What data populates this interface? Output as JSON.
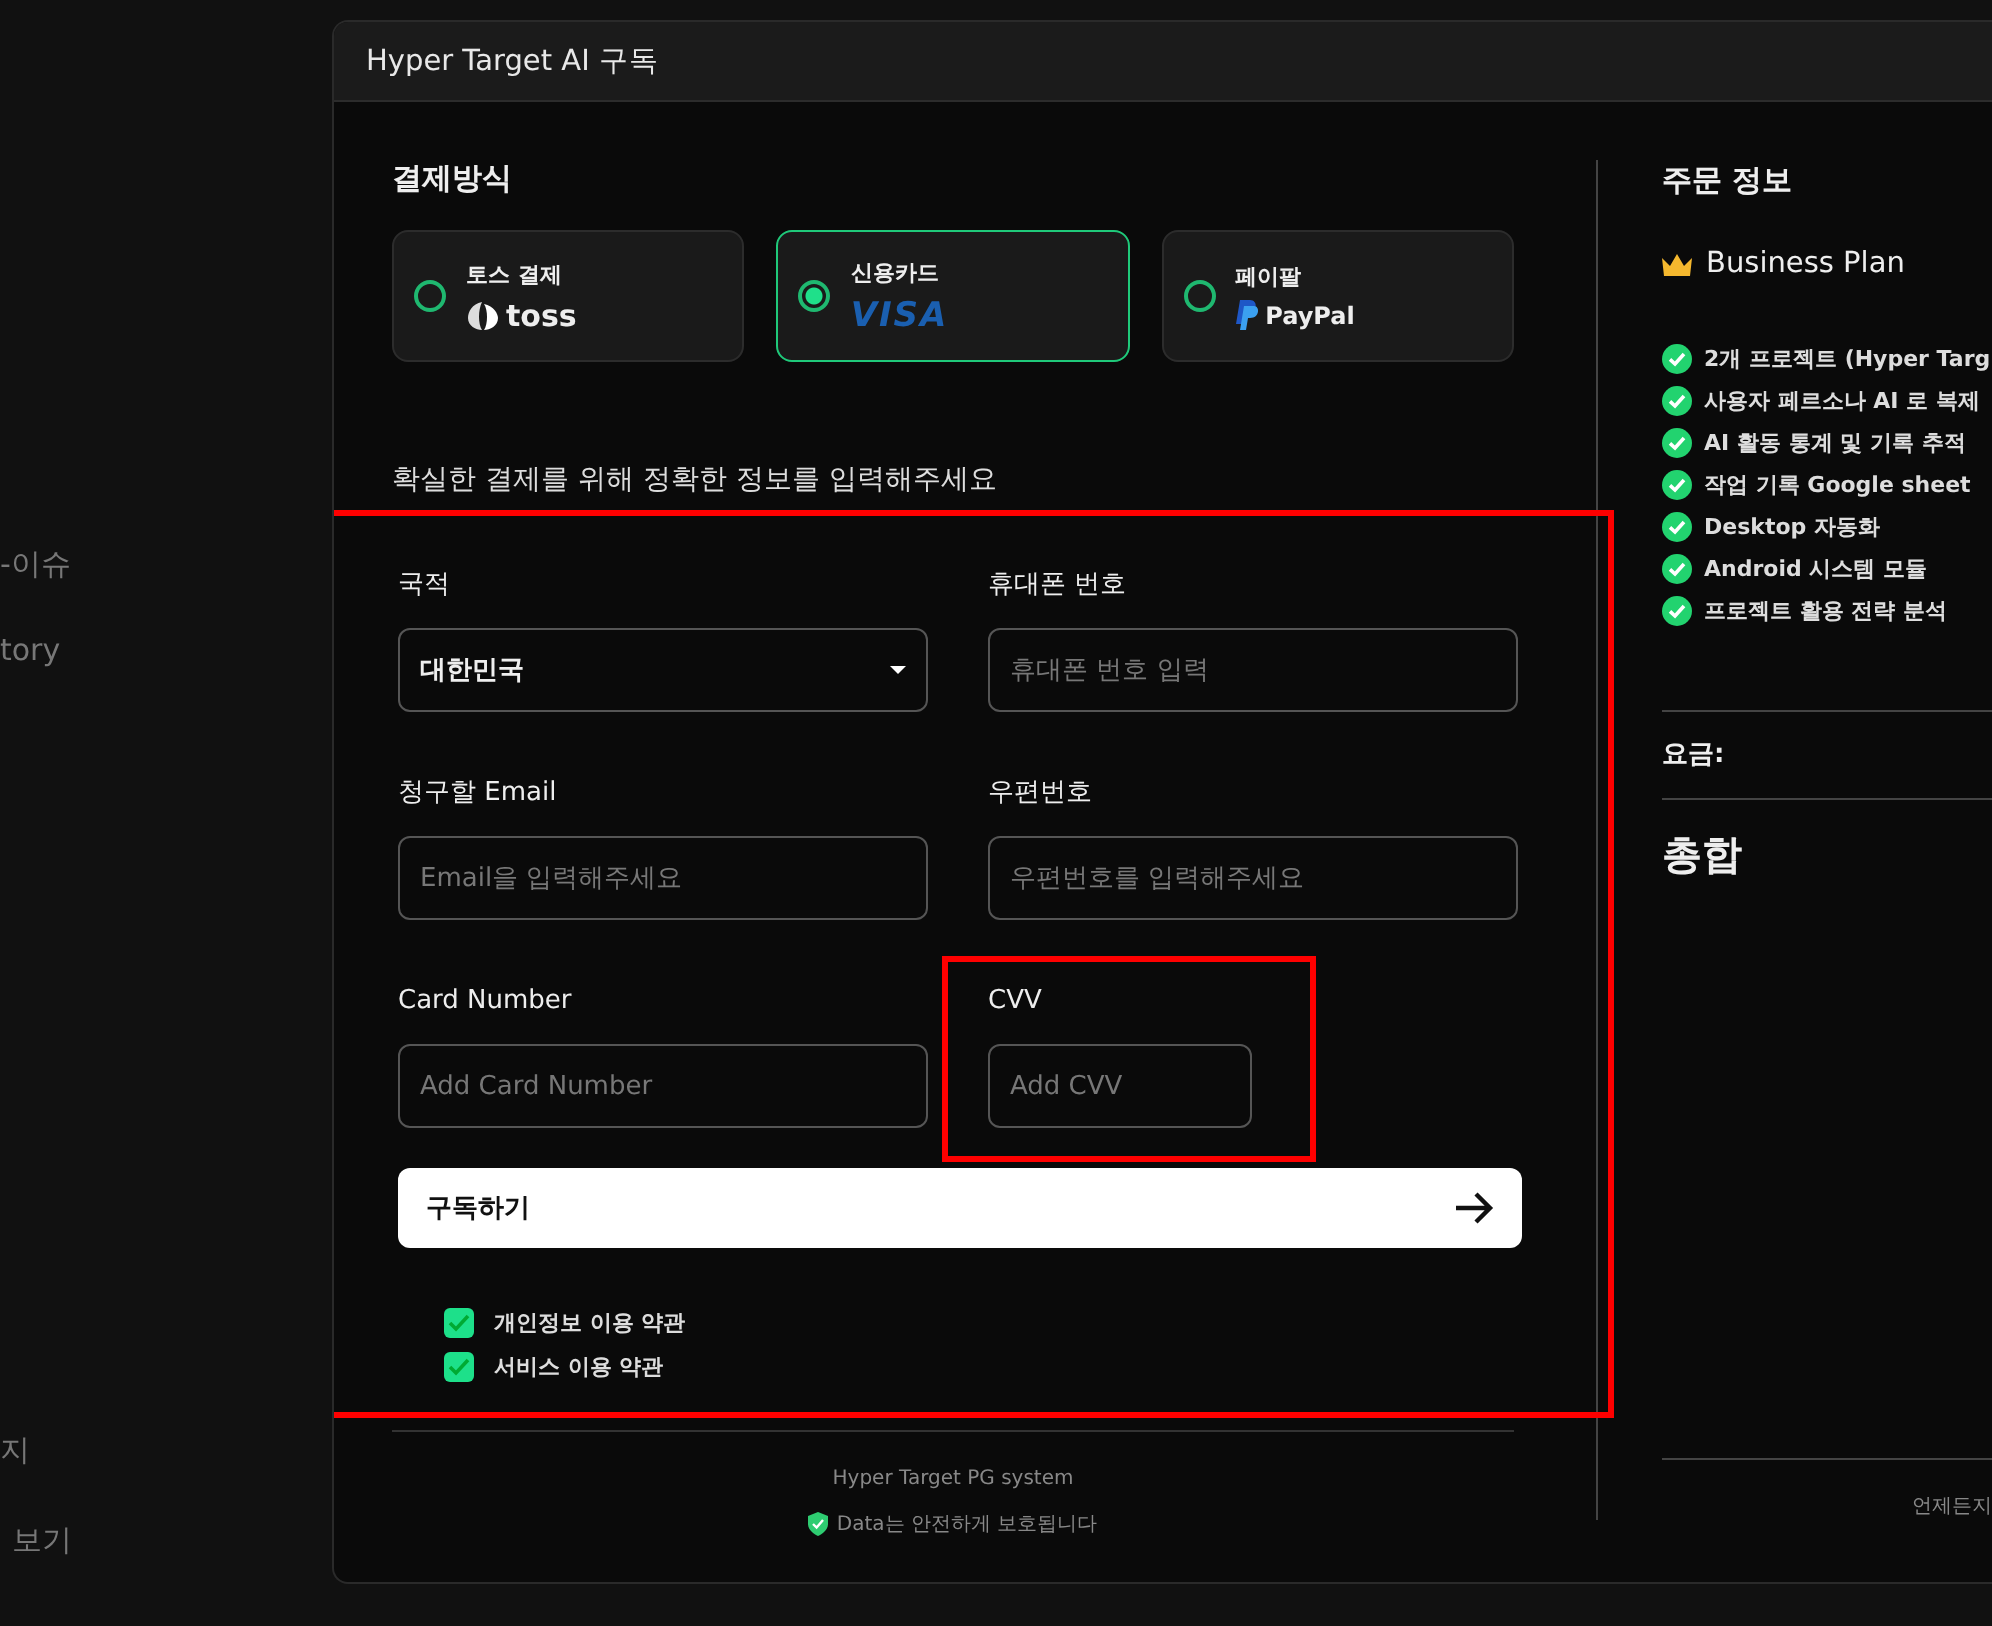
{
  "background_texts": [
    "-이슈",
    "tory",
    "지",
    "보기"
  ],
  "dialog": {
    "title": "Hyper Target AI 구독",
    "payment": {
      "heading": "결제방식",
      "methods": [
        {
          "label": "토스 결제",
          "brand": "toss",
          "kind": "toss",
          "selected": false
        },
        {
          "label": "신용카드",
          "brand": "VISA",
          "kind": "card",
          "selected": true
        },
        {
          "label": "페이팔",
          "brand": "PayPal",
          "kind": "paypal",
          "selected": false
        }
      ]
    },
    "instruction": "확실한 결제를 위해 정확한 정보를 입력해주세요",
    "form": {
      "highlighted": true,
      "fields": [
        {
          "label": "국적",
          "kind": "select",
          "value": "대한민국",
          "highlighted": false
        },
        {
          "label": "휴대폰 번호",
          "kind": "input",
          "placeholder": "휴대폰 번호 입력",
          "highlighted": false
        },
        {
          "label": "청구할 Email",
          "kind": "input",
          "placeholder": "Email을 입력해주세요",
          "highlighted": false
        },
        {
          "label": "우편번호",
          "kind": "input",
          "placeholder": "우편번호를 입력해주세요",
          "highlighted": false
        },
        {
          "label": "Card Number",
          "kind": "input",
          "placeholder": "Add Card Number",
          "highlighted": false
        },
        {
          "label": "CVV",
          "kind": "short",
          "placeholder": "Add CVV",
          "highlighted": true
        }
      ],
      "submit_button": {
        "label": "구독하기"
      },
      "agreements": [
        {
          "label": "개인정보 이용 약관",
          "checked": true
        },
        {
          "label": "서비스 이용 약관",
          "checked": true
        }
      ]
    },
    "footer": {
      "system_text": "Hyper Target PG system",
      "security_text": "Data는 안전하게 보호됩니다"
    },
    "order": {
      "heading": "주문 정보",
      "plan": "Business Plan",
      "features": [
        "2개 프로젝트 (Hyper Targ",
        "사용자 페르소나 AI 로 복제",
        "AI 활동 통계 및 기록 추적",
        "작업 기록 Google sheet",
        "Desktop 자동화",
        "Android 시스템 모듈",
        "프로젝트 활용 전략 분석"
      ],
      "fee_label": "요금:",
      "total_label": "총합",
      "footer_text": "언제든지"
    }
  }
}
